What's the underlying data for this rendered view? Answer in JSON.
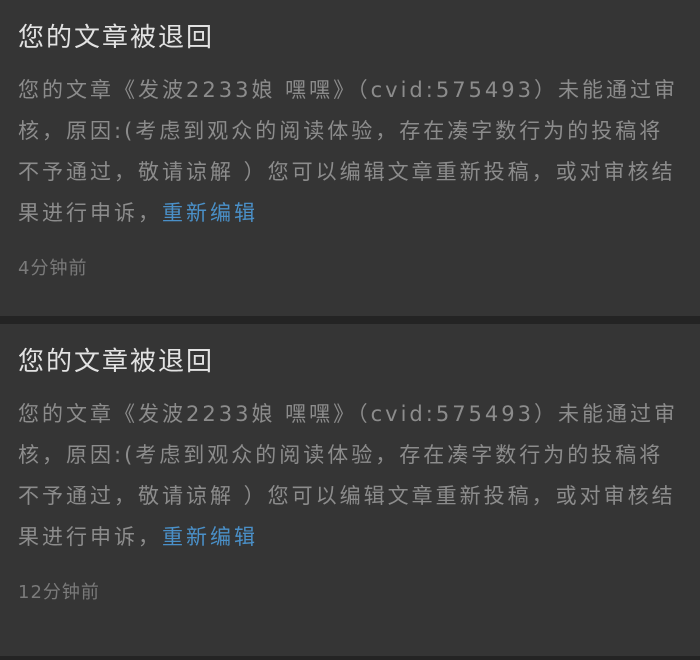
{
  "notifications": [
    {
      "title": "您的文章被退回",
      "message": "您的文章《发波2233娘 嘿嘿》（cvid:575493）未能通过审核，原因:(考虑到观众的阅读体验，存在凑字数行为的投稿将不予通过，敬请谅解 ）您可以编辑文章重新投稿，或对审核结果进行申诉，",
      "link": "重新编辑",
      "time": "4分钟前"
    },
    {
      "title": "您的文章被退回",
      "message": "您的文章《发波2233娘 嘿嘿》（cvid:575493）未能通过审核，原因:(考虑到观众的阅读体验，存在凑字数行为的投稿将不予通过，敬请谅解 ）您可以编辑文章重新投稿，或对审核结果进行申诉，",
      "link": "重新编辑",
      "time": "12分钟前"
    }
  ],
  "colors": {
    "background": "#353535",
    "separator": "#242424",
    "title": "#e2e2e2",
    "body": "#8c8c8c",
    "link": "#4a90c8",
    "time": "#7a7a7a"
  }
}
